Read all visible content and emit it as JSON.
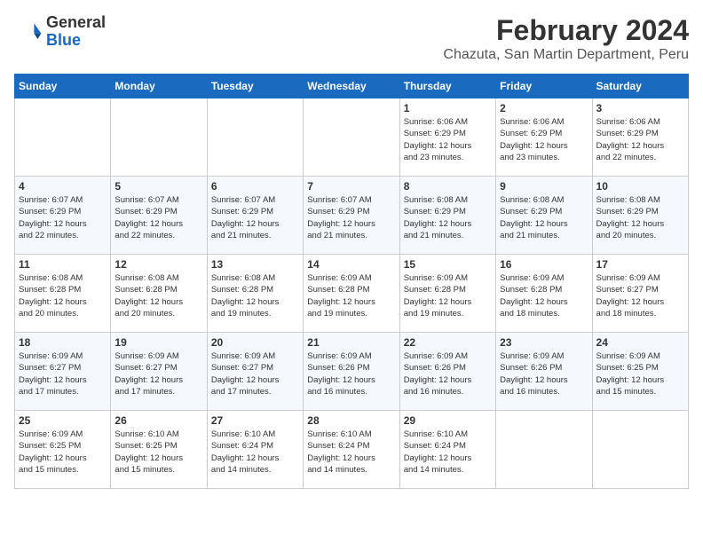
{
  "logo": {
    "general": "General",
    "blue": "Blue"
  },
  "title": {
    "month": "February 2024",
    "location": "Chazuta, San Martin Department, Peru"
  },
  "headers": [
    "Sunday",
    "Monday",
    "Tuesday",
    "Wednesday",
    "Thursday",
    "Friday",
    "Saturday"
  ],
  "weeks": [
    [
      {
        "day": "",
        "info": ""
      },
      {
        "day": "",
        "info": ""
      },
      {
        "day": "",
        "info": ""
      },
      {
        "day": "",
        "info": ""
      },
      {
        "day": "1",
        "info": "Sunrise: 6:06 AM\nSunset: 6:29 PM\nDaylight: 12 hours\nand 23 minutes."
      },
      {
        "day": "2",
        "info": "Sunrise: 6:06 AM\nSunset: 6:29 PM\nDaylight: 12 hours\nand 23 minutes."
      },
      {
        "day": "3",
        "info": "Sunrise: 6:06 AM\nSunset: 6:29 PM\nDaylight: 12 hours\nand 22 minutes."
      }
    ],
    [
      {
        "day": "4",
        "info": "Sunrise: 6:07 AM\nSunset: 6:29 PM\nDaylight: 12 hours\nand 22 minutes."
      },
      {
        "day": "5",
        "info": "Sunrise: 6:07 AM\nSunset: 6:29 PM\nDaylight: 12 hours\nand 22 minutes."
      },
      {
        "day": "6",
        "info": "Sunrise: 6:07 AM\nSunset: 6:29 PM\nDaylight: 12 hours\nand 21 minutes."
      },
      {
        "day": "7",
        "info": "Sunrise: 6:07 AM\nSunset: 6:29 PM\nDaylight: 12 hours\nand 21 minutes."
      },
      {
        "day": "8",
        "info": "Sunrise: 6:08 AM\nSunset: 6:29 PM\nDaylight: 12 hours\nand 21 minutes."
      },
      {
        "day": "9",
        "info": "Sunrise: 6:08 AM\nSunset: 6:29 PM\nDaylight: 12 hours\nand 21 minutes."
      },
      {
        "day": "10",
        "info": "Sunrise: 6:08 AM\nSunset: 6:29 PM\nDaylight: 12 hours\nand 20 minutes."
      }
    ],
    [
      {
        "day": "11",
        "info": "Sunrise: 6:08 AM\nSunset: 6:28 PM\nDaylight: 12 hours\nand 20 minutes."
      },
      {
        "day": "12",
        "info": "Sunrise: 6:08 AM\nSunset: 6:28 PM\nDaylight: 12 hours\nand 20 minutes."
      },
      {
        "day": "13",
        "info": "Sunrise: 6:08 AM\nSunset: 6:28 PM\nDaylight: 12 hours\nand 19 minutes."
      },
      {
        "day": "14",
        "info": "Sunrise: 6:09 AM\nSunset: 6:28 PM\nDaylight: 12 hours\nand 19 minutes."
      },
      {
        "day": "15",
        "info": "Sunrise: 6:09 AM\nSunset: 6:28 PM\nDaylight: 12 hours\nand 19 minutes."
      },
      {
        "day": "16",
        "info": "Sunrise: 6:09 AM\nSunset: 6:28 PM\nDaylight: 12 hours\nand 18 minutes."
      },
      {
        "day": "17",
        "info": "Sunrise: 6:09 AM\nSunset: 6:27 PM\nDaylight: 12 hours\nand 18 minutes."
      }
    ],
    [
      {
        "day": "18",
        "info": "Sunrise: 6:09 AM\nSunset: 6:27 PM\nDaylight: 12 hours\nand 17 minutes."
      },
      {
        "day": "19",
        "info": "Sunrise: 6:09 AM\nSunset: 6:27 PM\nDaylight: 12 hours\nand 17 minutes."
      },
      {
        "day": "20",
        "info": "Sunrise: 6:09 AM\nSunset: 6:27 PM\nDaylight: 12 hours\nand 17 minutes."
      },
      {
        "day": "21",
        "info": "Sunrise: 6:09 AM\nSunset: 6:26 PM\nDaylight: 12 hours\nand 16 minutes."
      },
      {
        "day": "22",
        "info": "Sunrise: 6:09 AM\nSunset: 6:26 PM\nDaylight: 12 hours\nand 16 minutes."
      },
      {
        "day": "23",
        "info": "Sunrise: 6:09 AM\nSunset: 6:26 PM\nDaylight: 12 hours\nand 16 minutes."
      },
      {
        "day": "24",
        "info": "Sunrise: 6:09 AM\nSunset: 6:25 PM\nDaylight: 12 hours\nand 15 minutes."
      }
    ],
    [
      {
        "day": "25",
        "info": "Sunrise: 6:09 AM\nSunset: 6:25 PM\nDaylight: 12 hours\nand 15 minutes."
      },
      {
        "day": "26",
        "info": "Sunrise: 6:10 AM\nSunset: 6:25 PM\nDaylight: 12 hours\nand 15 minutes."
      },
      {
        "day": "27",
        "info": "Sunrise: 6:10 AM\nSunset: 6:24 PM\nDaylight: 12 hours\nand 14 minutes."
      },
      {
        "day": "28",
        "info": "Sunrise: 6:10 AM\nSunset: 6:24 PM\nDaylight: 12 hours\nand 14 minutes."
      },
      {
        "day": "29",
        "info": "Sunrise: 6:10 AM\nSunset: 6:24 PM\nDaylight: 12 hours\nand 14 minutes."
      },
      {
        "day": "",
        "info": ""
      },
      {
        "day": "",
        "info": ""
      }
    ]
  ]
}
